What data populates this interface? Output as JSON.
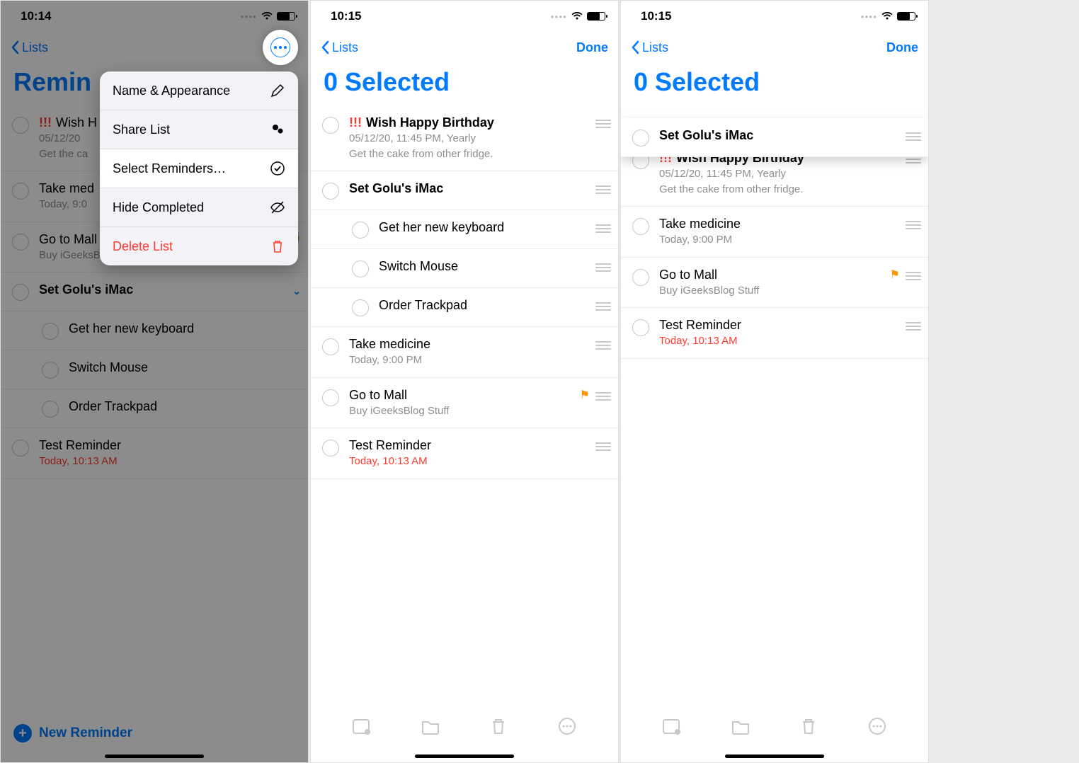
{
  "screen1": {
    "status_time": "10:14",
    "nav_back": "Lists",
    "title": "Remin",
    "menu": {
      "name_appearance": "Name & Appearance",
      "share_list": "Share List",
      "select_reminders": "Select Reminders…",
      "hide_completed": "Hide Completed",
      "delete_list": "Delete List"
    },
    "items": [
      {
        "priority": "!!!",
        "title": "Wish H",
        "sub1": "05/12/20",
        "sub2": "Get the ca"
      },
      {
        "title": "Take med",
        "sub1": "Today, 9:0"
      },
      {
        "title": "Go to Mall",
        "sub1": "Buy iGeeksBlog Stuff",
        "flag": true
      },
      {
        "title": "Set Golu's iMac",
        "bold": true,
        "expand": true
      },
      {
        "title": "Get her new keyboard",
        "indent": true
      },
      {
        "title": "Switch Mouse",
        "indent": true
      },
      {
        "title": "Order Trackpad",
        "indent": true
      },
      {
        "title": "Test Reminder",
        "sub1": "Today, 10:13 AM",
        "sub_red": true
      }
    ],
    "new_reminder": "New Reminder"
  },
  "screen2": {
    "status_time": "10:15",
    "nav_back": "Lists",
    "done": "Done",
    "title": "0 Selected",
    "items": [
      {
        "priority": "!!!",
        "title": "Wish Happy Birthday",
        "bold": true,
        "sub1": "05/12/20, 11:45 PM, Yearly",
        "sub2": "Get the cake from other fridge."
      },
      {
        "title": "Set Golu's iMac",
        "bold": true
      },
      {
        "title": "Get her new keyboard",
        "indent": true
      },
      {
        "title": "Switch Mouse",
        "indent": true
      },
      {
        "title": "Order Trackpad",
        "indent": true
      },
      {
        "title": "Take medicine",
        "sub1": "Today, 9:00 PM"
      },
      {
        "title": "Go to Mall",
        "sub1": "Buy iGeeksBlog Stuff",
        "flag": true
      },
      {
        "title": "Test Reminder",
        "sub1": "Today, 10:13 AM",
        "sub_red": true
      }
    ]
  },
  "screen3": {
    "status_time": "10:15",
    "nav_back": "Lists",
    "done": "Done",
    "title": "0 Selected",
    "floating": {
      "title": "Set Golu's iMac",
      "bold": true
    },
    "items": [
      {
        "priority": "!!!",
        "title": "Wish Happy Birthday",
        "bold": true,
        "sub1": "05/12/20, 11:45 PM, Yearly",
        "sub2": "Get the cake from other fridge."
      },
      {
        "title": "Take medicine",
        "sub1": "Today, 9:00 PM"
      },
      {
        "title": "Go to Mall",
        "sub1": "Buy iGeeksBlog Stuff",
        "flag": true
      },
      {
        "title": "Test Reminder",
        "sub1": "Today, 10:13 AM",
        "sub_red": true
      }
    ]
  }
}
